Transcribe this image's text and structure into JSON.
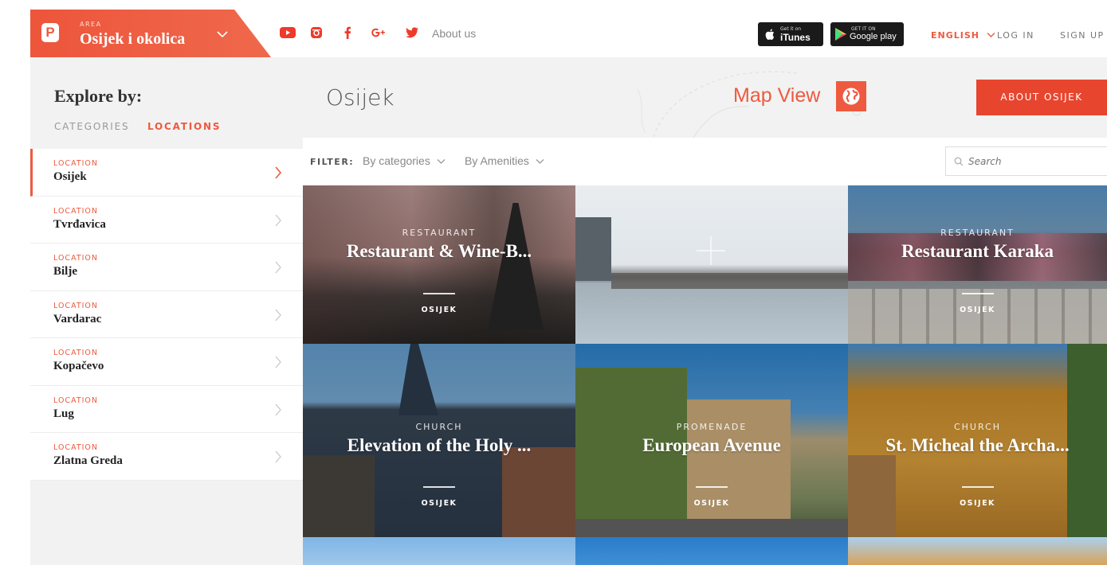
{
  "header": {
    "logo_letter": "P",
    "area_label": "AREA",
    "area_name": "Osijek i okolica",
    "about_link": "About us",
    "itunes_small": "Get it on",
    "itunes_label": "iTunes",
    "google_small": "GET IT ON",
    "google_label": "Google play",
    "language": "ENGLISH",
    "login": "LOG IN",
    "signup": "SIGN UP",
    "accent": "#ee5a3f"
  },
  "sidebar": {
    "heading": "Explore by:",
    "tabs": {
      "categories": "CATEGORIES",
      "locations": "LOCATIONS"
    },
    "items": [
      {
        "tag": "LOCATION",
        "name": "Osijek"
      },
      {
        "tag": "LOCATION",
        "name": "Tvrđavica"
      },
      {
        "tag": "LOCATION",
        "name": "Bilje"
      },
      {
        "tag": "LOCATION",
        "name": "Vardarac"
      },
      {
        "tag": "LOCATION",
        "name": "Kopačevo"
      },
      {
        "tag": "LOCATION",
        "name": "Lug"
      },
      {
        "tag": "LOCATION",
        "name": "Zlatna Greda"
      }
    ]
  },
  "main": {
    "title": "Osijek",
    "map_view": "Map View",
    "about_button": "ABOUT OSIJEK",
    "filter": {
      "label": "FILTER:",
      "by_categories": "By categories",
      "by_amenities": "By Amenities",
      "search_placeholder": "Search"
    },
    "tiles": [
      {
        "category": "RESTAURANT",
        "title": "Restaurant & Wine-B...",
        "city": "OSIJEK"
      },
      {
        "category": "",
        "title": "",
        "city": ""
      },
      {
        "category": "RESTAURANT",
        "title": "Restaurant Karaka",
        "city": "OSIJEK"
      },
      {
        "category": "CHURCH",
        "title": "Elevation of the Holy ...",
        "city": "OSIJEK"
      },
      {
        "category": "PROMENADE",
        "title": "European Avenue",
        "city": "OSIJEK"
      },
      {
        "category": "CHURCH",
        "title": "St. Micheal the Archa...",
        "city": "OSIJEK"
      }
    ]
  }
}
